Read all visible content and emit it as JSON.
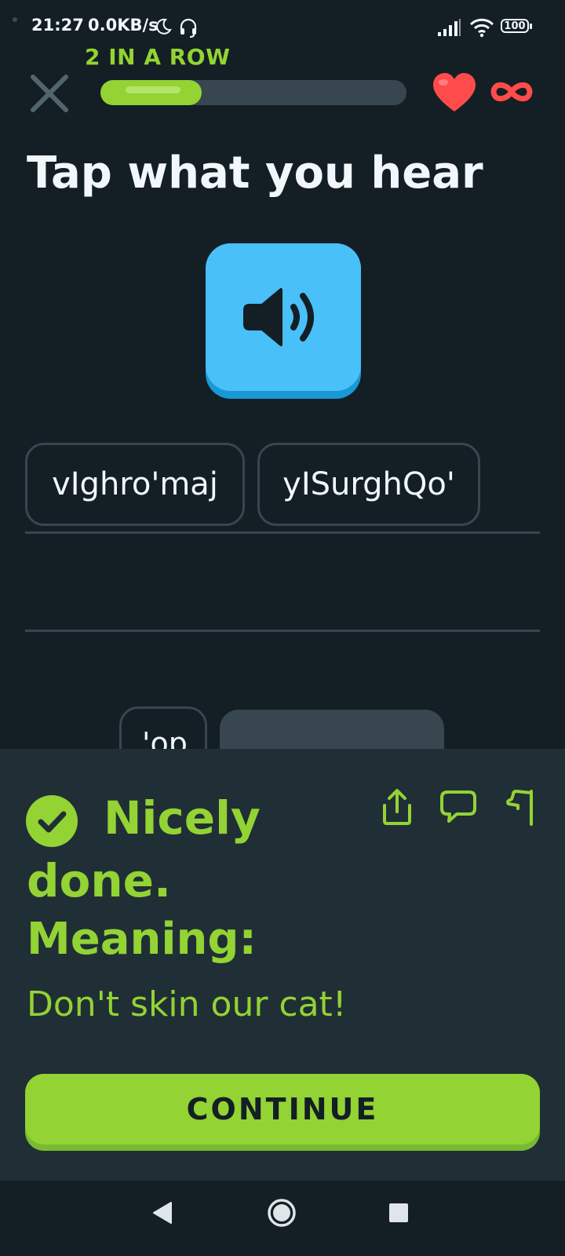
{
  "status_bar": {
    "time": "21:27",
    "speed": "0.0KB/s",
    "battery": "100",
    "icons": [
      "moon-icon",
      "headset-icon",
      "signal-icon",
      "wifi-icon",
      "battery-icon"
    ]
  },
  "header": {
    "streak_label": "2 IN A ROW",
    "progress": 0.33,
    "hearts": "infinite",
    "icons": [
      "close-icon",
      "heart-icon",
      "infinity-icon"
    ]
  },
  "exercise": {
    "title": "Tap what you hear",
    "speaker_icon": "speaker-icon",
    "selected_words": [
      "vIghro'maj",
      "yISurghQo'"
    ],
    "word_bank": [
      "'op"
    ]
  },
  "feedback": {
    "heading": "Nicely done.",
    "meaning_label": "Meaning:",
    "meaning_text": "Don't skin our cat!",
    "continue_label": "CONTINUE",
    "icons": [
      "check-circle-icon",
      "share-icon",
      "comment-icon",
      "flag-icon"
    ]
  },
  "colors": {
    "background": "#131f24",
    "panel": "#202f36",
    "accent_green": "#93d333",
    "speaker_blue": "#49c0f8",
    "heart_red": "#ff4b4b",
    "border_gray": "#37464f"
  }
}
